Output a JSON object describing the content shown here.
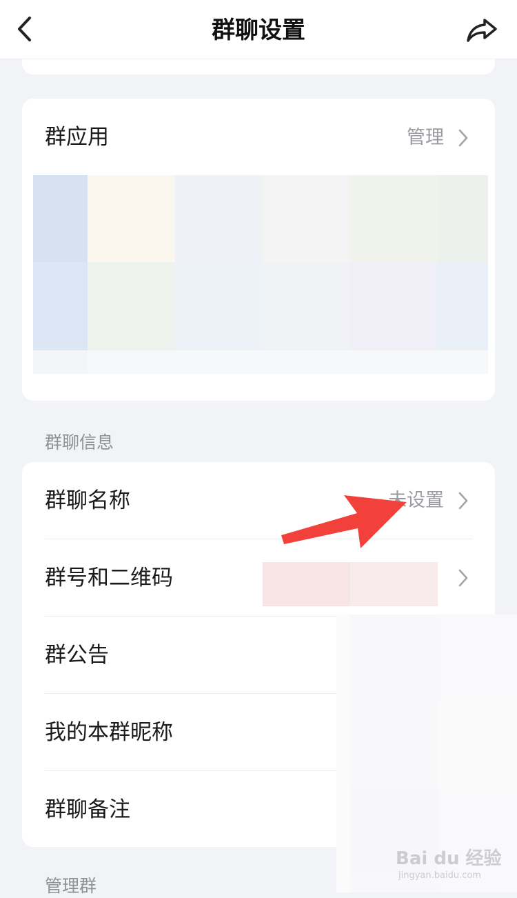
{
  "navbar": {
    "title": "群聊设置",
    "back_icon": "chevron-left-icon",
    "share_icon": "share-forward-icon"
  },
  "apps_card": {
    "title": "群应用",
    "manage_label": "管理"
  },
  "section_info": "群聊信息",
  "info_rows": [
    {
      "title": "群聊名称",
      "value": "未设置"
    },
    {
      "title": "群号和二维码",
      "value": ""
    },
    {
      "title": "群公告",
      "value": ""
    },
    {
      "title": "我的本群昵称",
      "value": ""
    },
    {
      "title": "群聊备注",
      "value": ""
    }
  ],
  "section_manage": "管理群",
  "watermark": {
    "brand": "Bai du 经验",
    "url": "jingyan.baidu.com"
  },
  "colors": {
    "background": "#f2f3f7",
    "card": "#ffffff",
    "annotation_red": "#f2413a",
    "secondary_text": "#9a9ba1"
  }
}
